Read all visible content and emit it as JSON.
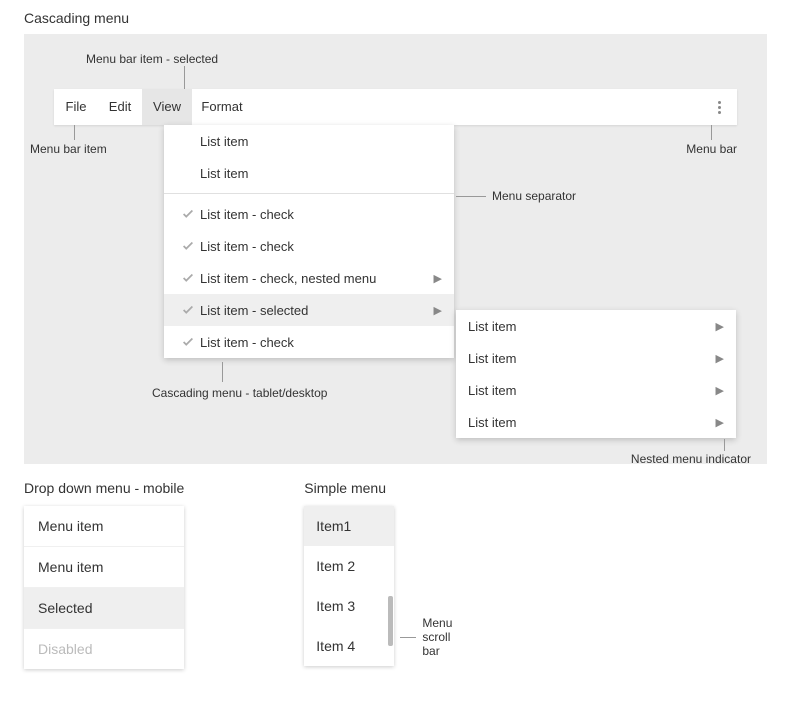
{
  "titles": {
    "cascading": "Cascading menu",
    "dropdown_mobile": "Drop down menu - mobile",
    "simple": "Simple menu"
  },
  "labels": {
    "menubar_item_selected": "Menu bar item - selected",
    "menubar_item": "Menu bar item",
    "menubar": "Menu bar",
    "menu_separator": "Menu separator",
    "cascading_desc": "Cascading menu - tablet/desktop",
    "nested_indicator": "Nested menu indicator",
    "menu_scrollbar": "Menu scroll bar"
  },
  "menubar": {
    "items": [
      "File",
      "Edit",
      "View",
      "Format"
    ],
    "selected_index": 2
  },
  "dropdown": {
    "items": [
      {
        "text": "List item",
        "check": false,
        "arrow": false,
        "selected": false
      },
      {
        "text": "List item",
        "check": false,
        "arrow": false,
        "selected": false
      }
    ],
    "items2": [
      {
        "text": "List item - check",
        "check": true,
        "arrow": false,
        "selected": false
      },
      {
        "text": "List item - check",
        "check": true,
        "arrow": false,
        "selected": false
      },
      {
        "text": "List item - check, nested menu",
        "check": true,
        "arrow": true,
        "selected": false
      },
      {
        "text": "List item - selected",
        "check": true,
        "arrow": true,
        "selected": true
      },
      {
        "text": "List item - check",
        "check": true,
        "arrow": false,
        "selected": false
      }
    ]
  },
  "nested": {
    "items": [
      {
        "text": "List item"
      },
      {
        "text": "List item"
      },
      {
        "text": "List item"
      },
      {
        "text": "List item"
      }
    ]
  },
  "mobile": {
    "items": [
      {
        "text": "Menu item",
        "state": "normal"
      },
      {
        "text": "Menu item",
        "state": "normal"
      },
      {
        "text": "Selected",
        "state": "selected"
      },
      {
        "text": "Disabled",
        "state": "disabled"
      }
    ]
  },
  "simple": {
    "items": [
      {
        "text": "Item1",
        "selected": true
      },
      {
        "text": "Item 2",
        "selected": false
      },
      {
        "text": "Item 3",
        "selected": false
      },
      {
        "text": "Item 4",
        "selected": false
      }
    ]
  }
}
